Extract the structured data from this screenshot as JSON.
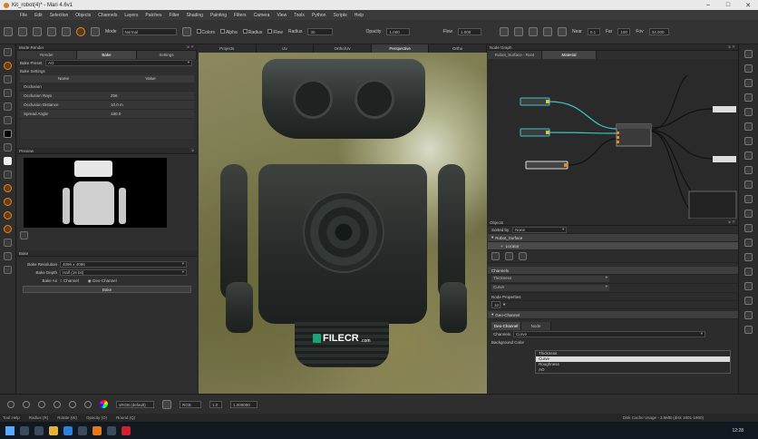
{
  "window": {
    "title": "Kit_robot(4)* - Mari 4.6v1"
  },
  "menu": [
    "File",
    "Edit",
    "Selection",
    "Objects",
    "Channels",
    "Layers",
    "Patches",
    "Filter",
    "Shading",
    "Painting",
    "Filters",
    "Camera",
    "View",
    "Tools",
    "Python",
    "Scripts",
    "Help"
  ],
  "toolbar": {
    "mode_label": "Mode",
    "mode_value": "Normal",
    "colors_label": "Colors",
    "alpha_label": "Alpha",
    "radius_label": "Radius",
    "flow_label": "Flow",
    "radius2_label": "Radius",
    "radius2_value": "30",
    "opacity_label": "Opacity",
    "opacity_value": "1.000",
    "flow2_label": "Flow",
    "flow2_value": "1.000",
    "near_label": "Near",
    "near_value": "0.1",
    "far_label": "Far",
    "far_value": "100",
    "fov_label": "Fov",
    "fov_value": "34.000"
  },
  "left_panel": {
    "title": "Mode Render",
    "tabs": [
      "Render",
      "Bake",
      "Settings"
    ],
    "bake_preset_label": "Bake Preset",
    "bake_preset_value": "AO",
    "bake_settings_label": "Bake Settings",
    "grid_headers": [
      "Name",
      "Value"
    ],
    "grid_section": "Occlusion",
    "grid_rows": [
      {
        "name": "Occlusion Rays",
        "value": "256"
      },
      {
        "name": "Occlusion Distance",
        "value": "10.0 m"
      },
      {
        "name": "Spread Angle",
        "value": "180.0"
      }
    ],
    "preview_title": "Preview",
    "bake_section": "Bake",
    "bake_resolution_label": "Bake Resolution",
    "bake_resolution_value": "4096 x 4096",
    "bake_depth_label": "Bake Depth",
    "bake_depth_value": "Half (16 bit)",
    "bake_as_label": "Bake As",
    "bake_as_channel": "Channel",
    "bake_as_geo": "Geo-Channel",
    "bake_button": "Bake"
  },
  "viewport": {
    "tabs": [
      "Projects",
      "Uv",
      "Ortho/Uv",
      "Perspective",
      "Ortho"
    ],
    "active_tab": "Perspective",
    "watermark": "FILECR",
    "watermark_sub": ".com"
  },
  "node_graph": {
    "title": "Node Graph",
    "tabs": [
      "Robot_Surface - Root",
      "Material"
    ]
  },
  "objects_panel": {
    "title": "Objects",
    "sorted_by_label": "Sorted by",
    "sorted_by_value": "None",
    "item": "Robot_Surface",
    "sub_item": "Locator",
    "channels_title": "Channels",
    "channels": [
      "Thickness",
      "Curve"
    ],
    "node_props_title": "Node Properties",
    "node_props_value": "10",
    "geo_channel_title": "Geo-Channel",
    "geo_tabs": [
      "Geo-Channel",
      "Node"
    ],
    "channels_field_label": "Channels",
    "channels_field_value": "Curve",
    "bg_color_label": "Background Color",
    "dropdown_options": [
      "Thickness",
      "Curve",
      "Roughness",
      "AO"
    ],
    "dropdown_selected": "Curve"
  },
  "bottom_bar": {
    "preset": "sRGB (default)",
    "colorspace": "RGB",
    "frame": "1.000000",
    "field": "1.0"
  },
  "hint_bar": [
    "Tool Help",
    "Radius (R)",
    "Rotate (W)",
    "Opacity (O)",
    "Round (Q)",
    "Disk Cache Usage - 3.9MB (disk 1801-1900)"
  ],
  "taskbar": {
    "time": "12:28"
  }
}
